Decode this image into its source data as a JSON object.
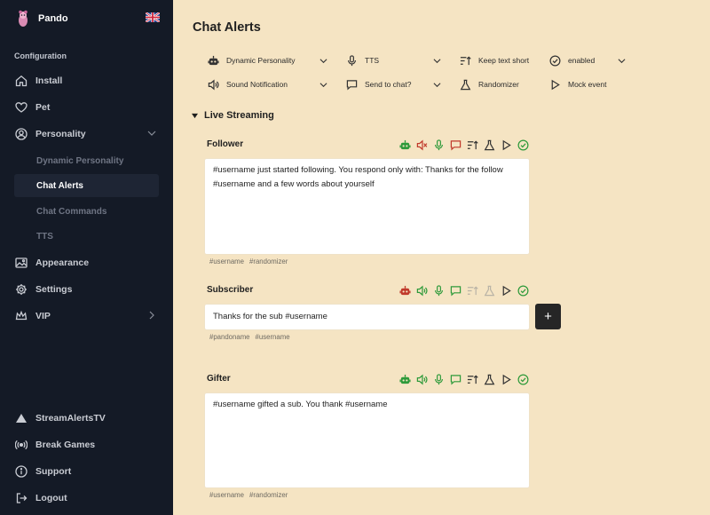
{
  "app": {
    "name": "Pando",
    "language_flag": "uk-flag-icon"
  },
  "sidebar": {
    "section_label": "Configuration",
    "items": [
      {
        "label": "Install",
        "icon": "home-icon"
      },
      {
        "label": "Pet",
        "icon": "heart-icon"
      },
      {
        "label": "Personality",
        "icon": "user-circle-icon"
      },
      {
        "label": "Appearance",
        "icon": "image-icon"
      },
      {
        "label": "Settings",
        "icon": "gear-icon"
      },
      {
        "label": "VIP",
        "icon": "crown-icon"
      }
    ],
    "sub_items": [
      {
        "label": "Dynamic Personality",
        "active": false
      },
      {
        "label": "Chat Alerts",
        "active": true
      },
      {
        "label": "Chat Commands",
        "active": false
      },
      {
        "label": "TTS",
        "active": false
      }
    ],
    "footer_items": [
      {
        "label": "StreamAlertsTV",
        "icon": "triangle-icon"
      },
      {
        "label": "Break Games",
        "icon": "broadcast-icon"
      },
      {
        "label": "Support",
        "icon": "info-icon"
      },
      {
        "label": "Logout",
        "icon": "logout-icon"
      }
    ]
  },
  "main": {
    "title": "Chat Alerts",
    "legend": [
      {
        "label": "Dynamic Personality",
        "icon": "robot-icon"
      },
      {
        "label": "TTS",
        "icon": "microphone-icon"
      },
      {
        "label": "Keep text short",
        "icon": "sort-icon"
      },
      {
        "label": "enabled",
        "icon": "check-circle-icon"
      },
      {
        "label": "Sound Notification",
        "icon": "speaker-icon"
      },
      {
        "label": "Send to chat?",
        "icon": "chat-bubble-icon"
      },
      {
        "label": "Randomizer",
        "icon": "flask-icon"
      },
      {
        "label": "Mock event",
        "icon": "play-icon"
      }
    ],
    "section": "Live Streaming",
    "alerts": [
      {
        "title": "Follower",
        "message": "#username just started following. You respond only with: Thanks for the follow #username and a few words about yourself",
        "tags": [
          "#username",
          "#randomizer"
        ]
      },
      {
        "title": "Subscriber",
        "message": "Thanks for the sub #username",
        "tags": [
          "#pandoname",
          "#username"
        ],
        "add_button": "+"
      },
      {
        "title": "Gifter",
        "message": "#username gifted a sub. You thank #username",
        "tags": [
          "#username",
          "#randomizer"
        ]
      }
    ]
  },
  "colors": {
    "sidebar_bg": "#141a26",
    "main_bg": "#f5e4c3",
    "active_green": "#2e9a3a",
    "inactive_red": "#c0392b",
    "disabled_gray": "#b9b3a6"
  }
}
